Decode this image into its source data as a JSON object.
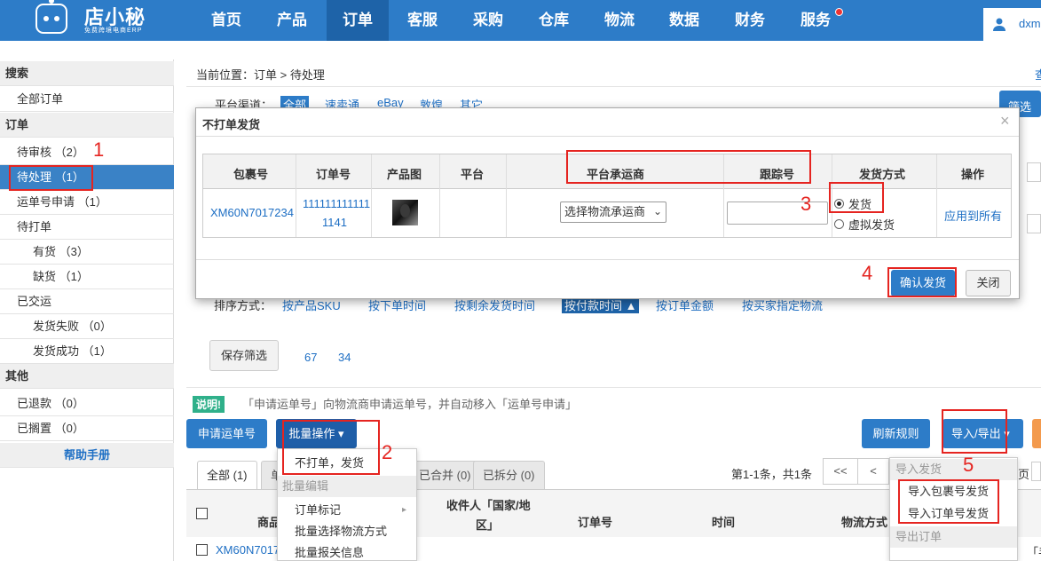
{
  "logo": {
    "name": "店小秘",
    "subtitle": "免费跨境电商ERP"
  },
  "nav": [
    "首页",
    "产品",
    "订单",
    "客服",
    "采购",
    "仓库",
    "物流",
    "数据",
    "财务",
    "服务"
  ],
  "user": {
    "name": "dxm"
  },
  "sidebar": {
    "search": "搜索",
    "all_orders": "全部订单",
    "orders": "订单",
    "pending_review": "待审核 （2）",
    "pending": "待处理 （1）",
    "waybill_apply": "运单号申请 （1）",
    "to_print": "待打单",
    "in_stock": "有货 （3）",
    "out_stock": "缺货 （1）",
    "shipped": "已交运",
    "ship_fail": "发货失败 （0）",
    "ship_ok": "发货成功 （1）",
    "other": "其他",
    "refunded": "已退款 （0）",
    "shelved": "已搁置 （0）",
    "help": "帮助手册"
  },
  "breadcrumb": {
    "prefix": "当前位置：",
    "path": "订单 > 待处理",
    "more": "查"
  },
  "platform": {
    "label": "平台渠道：",
    "options": [
      "全部",
      "速卖通",
      "eBay",
      "敦煌",
      "其它"
    ],
    "filter_btn": "筛选"
  },
  "sort": {
    "label": "排序方式：",
    "options": [
      "按产品SKU",
      "按下单时间",
      "按剩余发货时间",
      "按付款时间 ▲",
      "按订单金额",
      "按买家指定物流"
    ]
  },
  "save_filter": "保存筛选",
  "pages": [
    "67",
    "34"
  ],
  "note": {
    "tag": "说明!",
    "text": "「申请运单号」向物流商申请运单号，并自动移入「运单号申请」"
  },
  "toolbar": {
    "apply_waybill": "申请运单号",
    "batch": "批量操作 ▾",
    "refresh": "刷新规则",
    "import_export": "导入/导出",
    "io_caret": "▾"
  },
  "tabs": {
    "all": "全部 (1)",
    "single": "单",
    "merged": "已合并 (0)",
    "split": "已拆分 (0)"
  },
  "pagination": {
    "count": "第1-1条，共1条",
    "first": "<<",
    "prev": "<",
    "tail": "页"
  },
  "table_head": {
    "product": "商品",
    "recipient_l1": "收件人「国家/地",
    "recipient_l2": "区」",
    "order_no": "订单号",
    "time": "时间",
    "logistics": "物流方式"
  },
  "row": {
    "pkg": "XM60N7017",
    "tail": "「手"
  },
  "batch_menu": {
    "no_print_ship": "不打单，发货",
    "group_edit": "批量编辑",
    "order_mark": "订单标记",
    "choose_logistics": "批量选择物流方式",
    "customs": "批量报关信息",
    "arrow": "▸"
  },
  "io_menu": {
    "import_group": "导入发货",
    "import_pkg": "导入包裹号发货",
    "import_order": "导入订单号发货",
    "export_group": "导出订单"
  },
  "modal": {
    "title": "不打单发货",
    "close": "×",
    "headers": [
      "包裹号",
      "订单号",
      "产品图",
      "平台",
      "平台承运商",
      "跟踪号",
      "发货方式",
      "操作"
    ],
    "pkg": "XM60N7017234",
    "order_l1": "111111111111",
    "order_l2": "1141",
    "carrier_placeholder": "选择物流承运商",
    "carrier_chevron": "⌄",
    "ship_option": "发货",
    "virtual_option": "虚拟发货",
    "apply_all": "应用到所有",
    "confirm": "确认发货",
    "close_btn": "关闭"
  },
  "annotations": [
    "1",
    "2",
    "3",
    "4",
    "5"
  ],
  "colors": {
    "brand_blue": "#2d7cc8",
    "annotation_red": "#e52420",
    "note_green": "#2fb08a",
    "accent_orange": "#f39a4d"
  }
}
